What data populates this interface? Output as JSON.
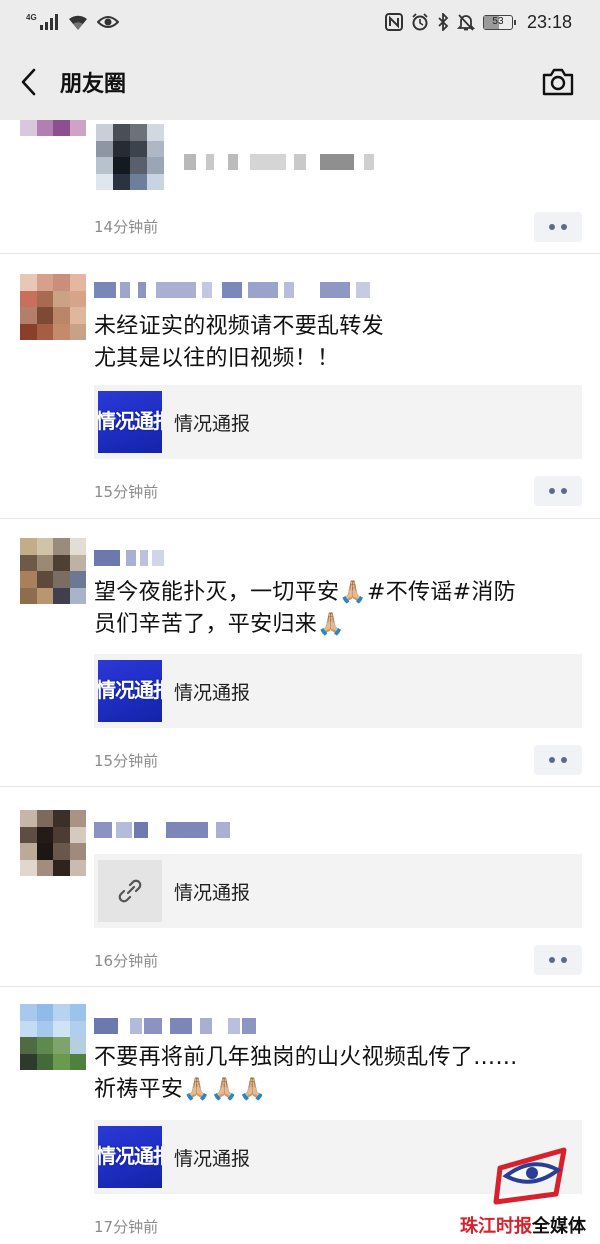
{
  "status_bar": {
    "network_label": "4G",
    "time": "23:18",
    "battery_level": "53",
    "battery_fraction": 0.53,
    "icons": [
      "signal-icon",
      "wifi-icon",
      "eye-icon",
      "nfc-icon",
      "alarm-icon",
      "bluetooth-icon",
      "bell-off-icon",
      "battery-icon"
    ]
  },
  "nav": {
    "title": "朋友圈",
    "back_icon": "chevron-left-icon",
    "camera_icon": "camera-icon"
  },
  "posts": [
    {
      "time": "14分钟前"
    },
    {
      "text_line1": "未经证实的视频请不要乱转发",
      "text_line2": "尤其是以往的旧视频！！",
      "card_thumb_text": "情况通报",
      "card_title": "情况通报",
      "time": "15分钟前"
    },
    {
      "text_line1": "望今夜能扑灭，一切平安🙏🏼#不传谣#消防",
      "text_line2": "员们辛苦了，平安归来🙏🏼",
      "card_thumb_text": "情况通报",
      "card_title": "情况通报",
      "time": "15分钟前"
    },
    {
      "card_title": "情况通报",
      "card_icon": "link-icon",
      "time": "16分钟前"
    },
    {
      "text_line1": "不要再将前几年独岗的山火视频乱传了……",
      "text_line2": "祈祷平安🙏🏼🙏🏼🙏🏼",
      "card_thumb_text": "情况通报",
      "card_title": "情况通报",
      "time": "17分钟前"
    }
  ],
  "watermark": {
    "brand_red": "珠江时报",
    "brand_black": "全媒体"
  },
  "colors": {
    "bar_bg": "#ececec",
    "timestamp": "#8c8c8c",
    "card_bg": "#f3f3f3",
    "thumb_blue": "#1f2ec4",
    "watermark_red": "#d8212c"
  }
}
